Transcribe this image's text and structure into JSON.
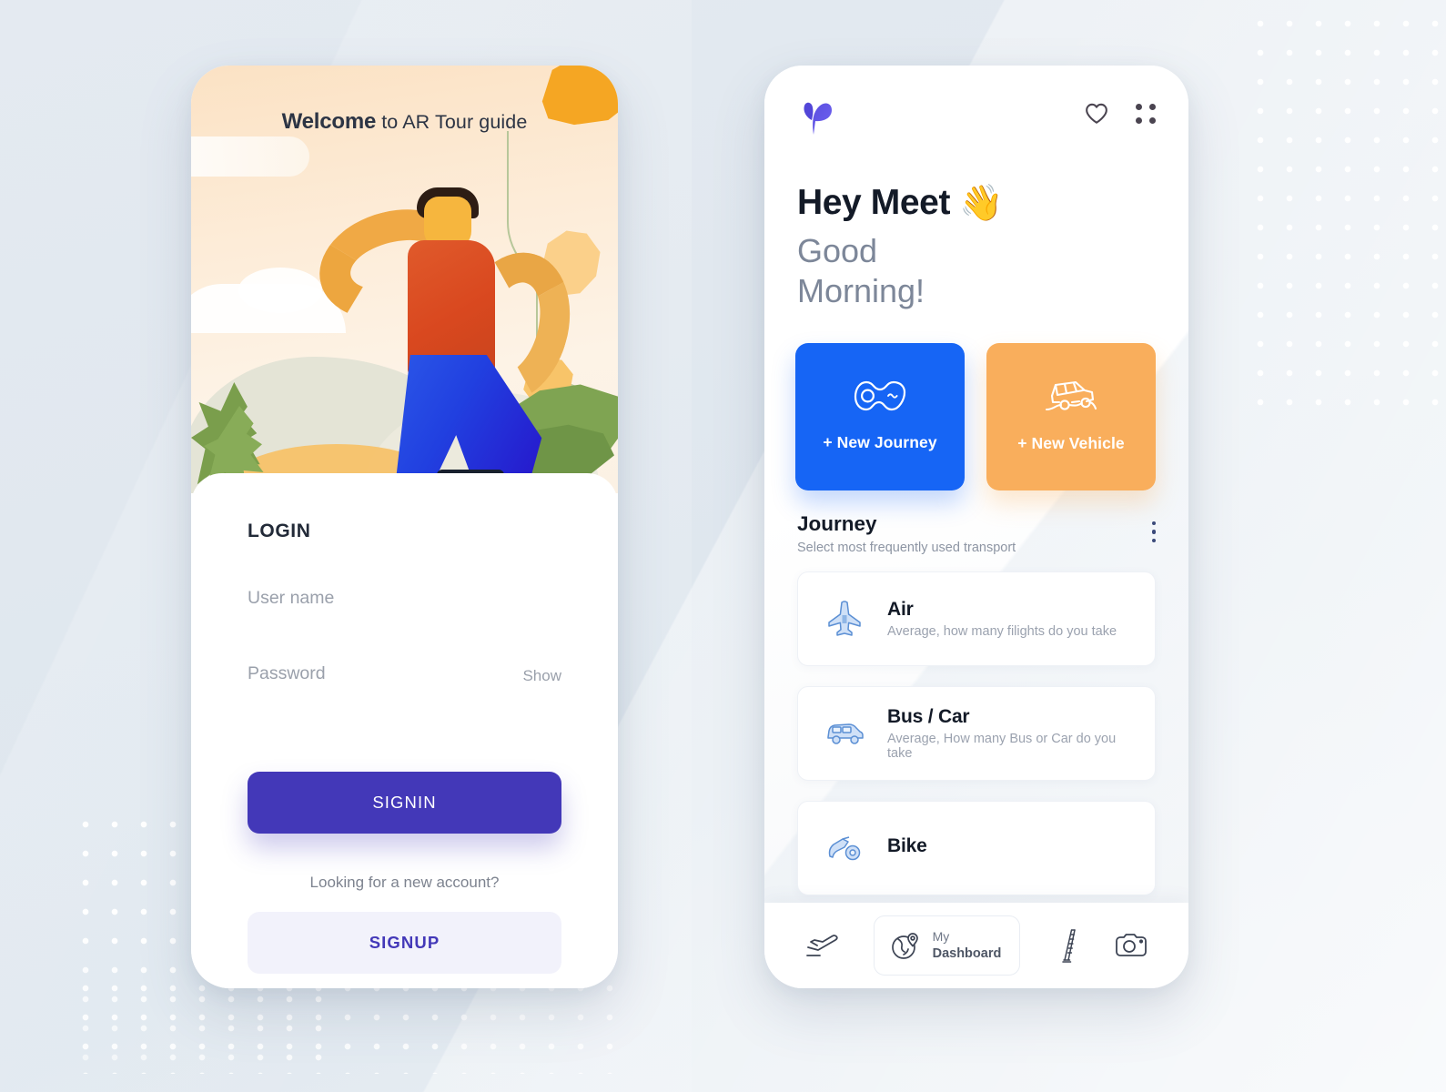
{
  "theme": {
    "page_bg": "#e2e9f0",
    "accent_indigo": "#4338b8",
    "accent_blue": "#1665f5",
    "accent_orange": "#f9ae5c",
    "text_dark": "#131a27",
    "text_muted": "#9aa0ab"
  },
  "left_phone": {
    "hero": {
      "welcome_bold": "Welcome",
      "welcome_rest": " to AR Tour guide",
      "illustration_name": "traveler-illustration"
    },
    "login": {
      "title": "LOGIN",
      "username_placeholder": "User name",
      "username_value": "",
      "password_placeholder": "Password",
      "password_value": "",
      "show_label": "Show",
      "signin_label": "SIGNIN",
      "new_account_text": "Looking for a new account?",
      "signup_label": "SIGNUP"
    }
  },
  "right_phone": {
    "header": {
      "logo_name": "sprout-logo",
      "heart_icon": "heart-icon",
      "grid_icon": "grid-menu-icon"
    },
    "greeting": {
      "hey": "Hey Meet",
      "wave_emoji": "👋",
      "line1": "Good",
      "line2": "Morning!"
    },
    "actions": [
      {
        "label": "+ New Journey",
        "icon": "route-icon",
        "color": "#1665f5"
      },
      {
        "label": "+ New Vehicle",
        "icon": "offroad-jeep-icon",
        "color": "#f9ae5c"
      }
    ],
    "journey": {
      "title": "Journey",
      "subtitle": "Select most frequently used transport",
      "menu_icon": "kebab-menu-icon"
    },
    "transports": [
      {
        "title": "Air",
        "desc": "Average, how many filights do you take",
        "icon": "airplane-icon"
      },
      {
        "title": "Bus / Car",
        "desc": "Average, How many Bus or Car do you take",
        "icon": "car-icon"
      },
      {
        "title": "Bike",
        "desc": "",
        "icon": "motorbike-icon"
      }
    ],
    "bottom_nav": [
      {
        "name": "flights",
        "icon": "airplane-takeoff-icon",
        "label": ""
      },
      {
        "name": "dashboard",
        "icon": "globe-pin-icon",
        "label_line1": "My",
        "label_line2": "Dashboard"
      },
      {
        "name": "landmarks",
        "icon": "pisa-tower-icon",
        "label": ""
      },
      {
        "name": "camera",
        "icon": "camera-icon",
        "label": ""
      }
    ]
  }
}
